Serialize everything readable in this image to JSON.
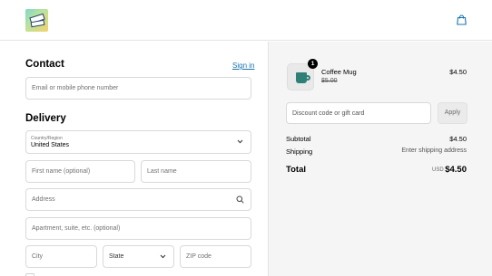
{
  "header": {
    "logo_icon": "price-tags-logo",
    "cart_icon": "shopping-bag-icon"
  },
  "contact": {
    "heading": "Contact",
    "signin_label": "Sign in",
    "email_placeholder": "Email or mobile phone number"
  },
  "delivery": {
    "heading": "Delivery",
    "country_label": "Country/Region",
    "country_value": "United States",
    "first_name_placeholder": "First name (optional)",
    "last_name_placeholder": "Last name",
    "address_placeholder": "Address",
    "apartment_placeholder": "Apartment, suite, etc. (optional)",
    "city_placeholder": "City",
    "state_value": "State",
    "zip_placeholder": "ZIP code"
  },
  "order": {
    "item": {
      "name": "Coffee Mug",
      "quantity": "1",
      "original_price": "$5.00",
      "price": "$4.50"
    },
    "discount_placeholder": "Discount code or gift card",
    "apply_label": "Apply",
    "subtotal_label": "Subtotal",
    "subtotal_value": "$4.50",
    "shipping_label": "Shipping",
    "shipping_value": "Enter shipping address",
    "total_label": "Total",
    "total_currency": "USD",
    "total_value": "$4.50"
  },
  "colors": {
    "link": "#1773b0",
    "summary_bg": "#f5f5f5",
    "mug": "#2f7f77"
  }
}
